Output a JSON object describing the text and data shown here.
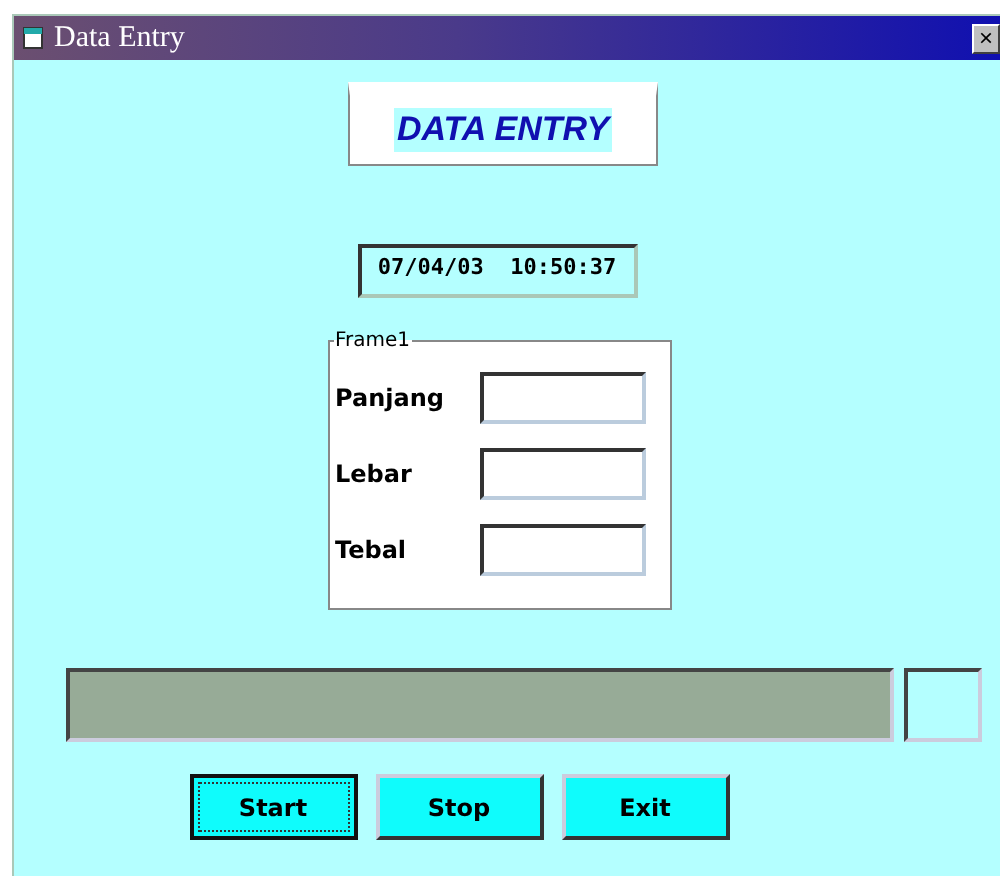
{
  "window": {
    "title": "Data Entry",
    "close": "×"
  },
  "heading": "DATA ENTRY",
  "clock": "07/04/03  10:50:37",
  "frame": {
    "caption": "Frame1",
    "fields": [
      {
        "label": "Panjang"
      },
      {
        "label": "Lebar"
      },
      {
        "label": "Tebal"
      }
    ]
  },
  "buttons": [
    {
      "label": "Start",
      "focused": true
    },
    {
      "label": "Stop",
      "focused": false
    },
    {
      "label": "Exit",
      "focused": false
    }
  ]
}
